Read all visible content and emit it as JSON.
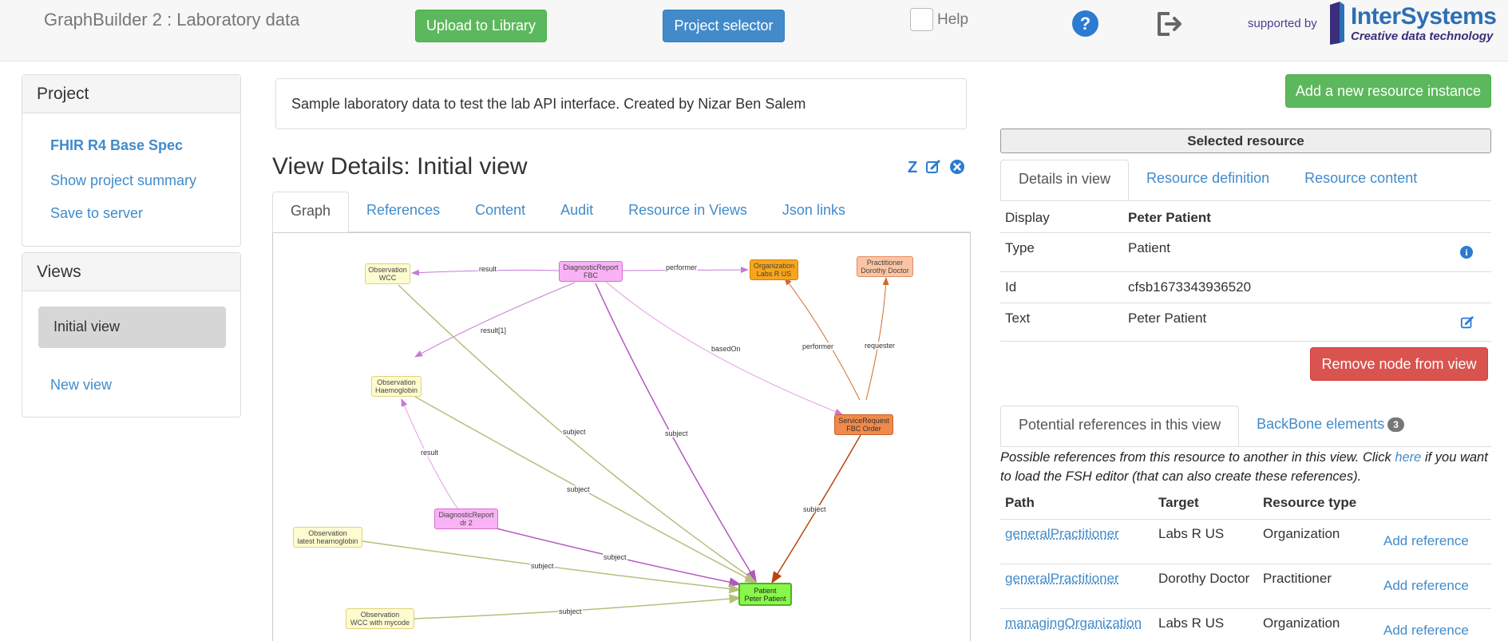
{
  "header": {
    "title": "GraphBuilder 2 : Laboratory data",
    "upload_label": "Upload to Library",
    "project_selector_label": "Project selector",
    "help_label": "Help",
    "help_icon": "?",
    "supported_by": "supported by",
    "logo_name": "InterSystems",
    "logo_tagline": "Creative data technology"
  },
  "project_panel": {
    "title": "Project",
    "items": [
      "FHIR R4 Base Spec",
      "Show project summary",
      "Save to server"
    ]
  },
  "views_panel": {
    "title": "Views",
    "active_view": "Initial view",
    "new_view": "New view"
  },
  "description": "Sample laboratory data to test the lab API interface. Created by Nizar Ben Salem",
  "view": {
    "title": "View Details: Initial view",
    "z_label": "Z",
    "tabs": [
      "Graph",
      "References",
      "Content",
      "Audit",
      "Resource in Views",
      "Json links"
    ]
  },
  "graph": {
    "nodes": [
      {
        "line1": "Observation",
        "line2": "WCC"
      },
      {
        "line1": "DiagnosticReport",
        "line2": "FBC"
      },
      {
        "line1": "Organization",
        "line2": "Labs R US"
      },
      {
        "line1": "Practitioner",
        "line2": "Dorothy Doctor"
      },
      {
        "line1": "Observation",
        "line2": "Haemoglobin"
      },
      {
        "line1": "ServiceRequest",
        "line2": "FBC Order"
      },
      {
        "line1": "DiagnosticReport",
        "line2": "dr 2"
      },
      {
        "line1": "Observation",
        "line2": "latest hearnoglobin"
      },
      {
        "line1": "Observation",
        "line2": "WCC with mycode"
      },
      {
        "line1": "Patient",
        "line2": "Peter Patient"
      }
    ],
    "edge_labels": {
      "result": "result",
      "performer_top": "performer",
      "result1": "result[1]",
      "basedOn": "basedOn",
      "performer": "performer",
      "requester": "requester",
      "result_dr2": "result",
      "subject": "subject"
    }
  },
  "right": {
    "add_resource_label": "Add a new resource instance",
    "selected_resource_title": "Selected resource",
    "tabs": [
      "Details in view",
      "Resource definition",
      "Resource content"
    ],
    "details": [
      {
        "label": "Display",
        "value": "Peter Patient"
      },
      {
        "label": "Type",
        "value": "Patient"
      },
      {
        "label": "Id",
        "value": "cfsb1673343936520"
      },
      {
        "label": "Text",
        "value": "Peter Patient"
      }
    ],
    "remove_node_label": "Remove node from view",
    "ref_tabs": [
      "Potential references in this view",
      "BackBone elements"
    ],
    "backbone_count": "3",
    "pref_text_1": "Possible references from this resource to another in this view. Click",
    "pref_here": "here",
    "pref_text_2": "if you want to load the FSH editor (that can also create these references).",
    "ref_columns": [
      "Path",
      "Target",
      "Resource type"
    ],
    "references": [
      {
        "path": "generalPractitioner",
        "target": "Labs R US",
        "type": "Organization",
        "action": "Add reference"
      },
      {
        "path": "generalPractitioner",
        "target": "Dorothy Doctor",
        "type": "Practitioner",
        "action": "Add reference"
      },
      {
        "path": "managingOrganization",
        "target": "Labs R US",
        "type": "Organization",
        "action": "Add reference"
      }
    ]
  },
  "colors": {
    "green_button": "#5cb85c",
    "blue_button": "#428bca",
    "red_button": "#d9534f",
    "link": "#428bca"
  }
}
